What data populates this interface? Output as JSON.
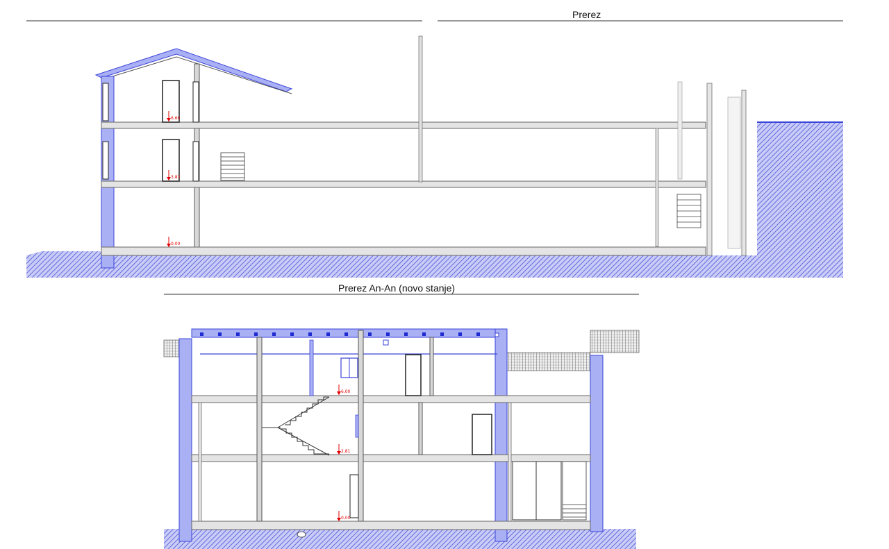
{
  "section_top": {
    "title": "Prerez",
    "levels": [
      "6,60",
      "3,83",
      "0,00"
    ]
  },
  "section_bottom": {
    "title": "Prerez An-An (novo stanje)",
    "levels": [
      "6,00",
      "2,81",
      "0,00"
    ]
  },
  "colors": {
    "wall_fill": "#aab0f4",
    "wall_stroke": "#3a44d8",
    "ground_hatch": "#4a52d6",
    "level_mark": "#e00000",
    "line": "#555555"
  }
}
